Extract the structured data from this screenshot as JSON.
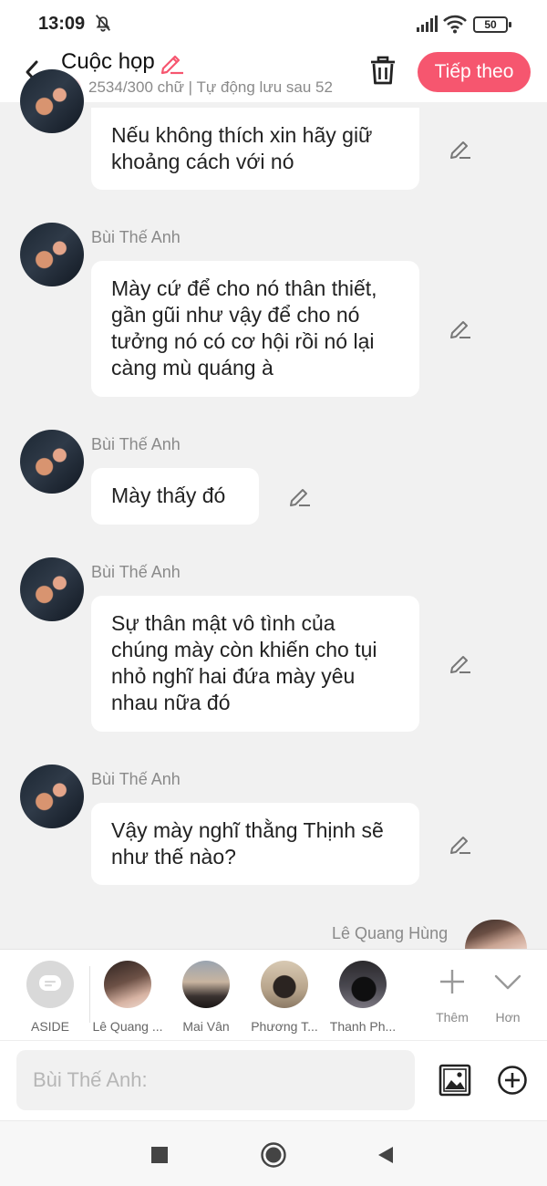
{
  "status_bar": {
    "time": "13:09",
    "battery": "50"
  },
  "header": {
    "title": "Cuộc họp",
    "subline": "2534/300 chữ | Tự động lưu sau 52",
    "next_label": "Tiếp theo"
  },
  "messages": [
    {
      "sender": "",
      "text": "Nếu không thích xin hãy giữ\nkhoảng cách với nó"
    },
    {
      "sender": "Bùi Thế Anh",
      "text": "Mày cứ để cho nó thân thiết,\ngần gũi như vậy để cho nó\ntưởng nó có cơ hội rồi nó lại\ncàng mù quáng à"
    },
    {
      "sender": "Bùi Thế Anh",
      "text": "Mày thấy đó"
    },
    {
      "sender": "Bùi Thế Anh",
      "text": "Sự thân mật vô tình của\nchúng mày còn khiến cho tụi\nnhỏ nghĩ hai đứa mày yêu\nnhau nữa đó"
    },
    {
      "sender": "Bùi Thế Anh",
      "text": "Vậy mày nghĩ thằng Thịnh sẽ\nnhư thế nào?"
    },
    {
      "sender": "Lê Quang Hùng",
      "text": ""
    }
  ],
  "characters": [
    {
      "label": "ASIDE"
    },
    {
      "label": "Lê Quang ..."
    },
    {
      "label": "Mai Vân"
    },
    {
      "label": "Phương T..."
    },
    {
      "label": "Thanh Ph..."
    }
  ],
  "tools": {
    "more_label": "Thêm",
    "expand_label": "Hơn"
  },
  "input": {
    "placeholder": "Bùi Thế Anh:"
  },
  "colors": {
    "accent": "#f6566f",
    "background": "#f1f1f1",
    "bubble": "#ffffff"
  }
}
